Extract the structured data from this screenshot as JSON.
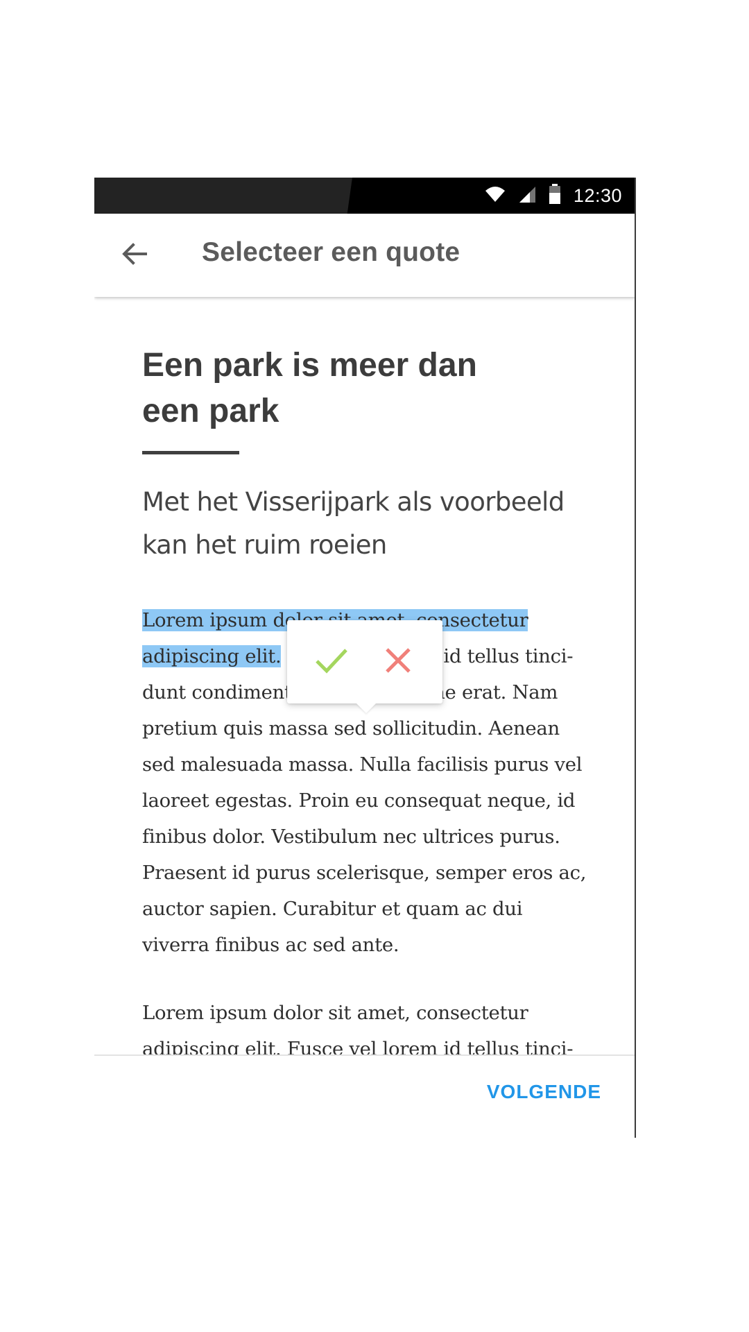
{
  "status_bar": {
    "time": "12:30",
    "icons": [
      "wifi-icon",
      "signal-icon",
      "battery-icon"
    ]
  },
  "app_bar": {
    "back_icon": "arrow-back-icon",
    "title": "Selecteer een quote"
  },
  "article": {
    "title": "Een park is meer dan een park",
    "subtitle": "Met het Visserijpark als voorbeeld kan het ruim                  roeien",
    "paragraph1_highlight": "Lorem ipsum dolor sit amet, consectetur adipiscing elit.",
    "paragraph1_rest": " Fusce vel lorem id tellus tinci-dunt condimentum sit amet vitae erat. Nam pretium quis massa sed sollicitudin. Aenean sed malesuada massa. Nulla facilisis purus vel laoreet egestas. Proin eu consequat neque, id finibus dolor. Vestibulum nec ultrices purus. Praesent id purus scelerisque, semper eros ac, auctor sapien. Curabitur et quam ac dui viverra finibus ac sed ante.",
    "paragraph2": "Lorem ipsum dolor sit amet, consectetur adipiscing elit. Fusce vel lorem id tellus tinci-"
  },
  "selection_popup": {
    "confirm_icon": "check-icon",
    "cancel_icon": "close-icon"
  },
  "footer": {
    "next_label": "VOLGENDE"
  },
  "colors": {
    "highlight": "#8ec8f5",
    "confirm": "#a4d65e",
    "cancel": "#f0807a",
    "accent": "#2196e8"
  }
}
